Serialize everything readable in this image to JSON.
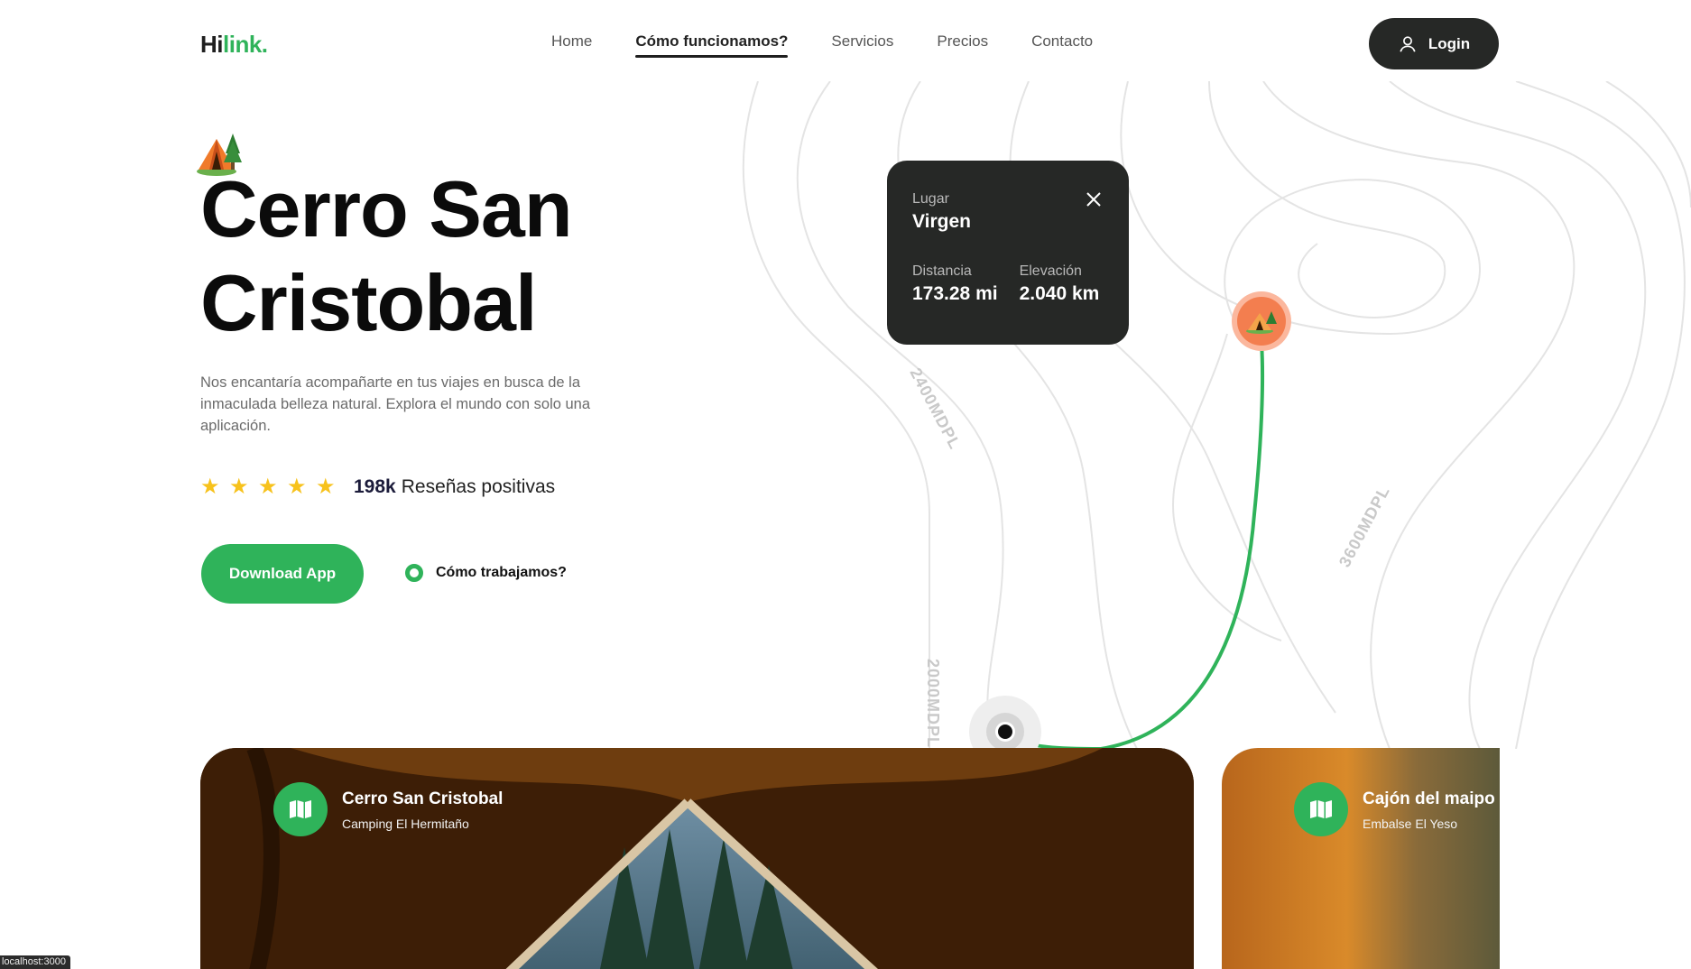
{
  "header": {
    "logo_hi": "Hi",
    "logo_link": "link.",
    "nav": [
      {
        "label": "Home",
        "active": false
      },
      {
        "label": "Cómo funcionamos?",
        "active": true
      },
      {
        "label": "Servicios",
        "active": false
      },
      {
        "label": "Precios",
        "active": false
      },
      {
        "label": "Contacto",
        "active": false
      }
    ],
    "login_label": "Login"
  },
  "hero": {
    "title_line1": "Cerro San",
    "title_line2": "Cristobal",
    "description": "Nos encantaría acompañarte en tus viajes en busca de la inmaculada belleza natural. Explora el mundo con solo una aplicación.",
    "rating_stars": 5,
    "rating_count": "198k",
    "rating_label": "Reseñas positivas",
    "download_label": "Download App",
    "how_label": "Cómo trabajamos?"
  },
  "map": {
    "contour_labels": [
      "2400MDPL",
      "3600MDPL",
      "2000MDPL"
    ],
    "route_color": "#2fb35a",
    "pin_color": "#f37e4f",
    "info": {
      "place_label": "Lugar",
      "place_value": "Virgen",
      "distance_label": "Distancia",
      "distance_value": "173.28 mi",
      "elevation_label": "Elevación",
      "elevation_value": "2.040 km"
    }
  },
  "cards": [
    {
      "title": "Cerro San Cristobal",
      "subtitle": "Camping El Hermitaño",
      "icon": "map-icon"
    },
    {
      "title": "Cajón del maipo",
      "subtitle": "Embalse El Yeso",
      "icon": "map-icon"
    }
  ],
  "status": {
    "url": "localhost:3000"
  },
  "colors": {
    "accent": "#2fb35a",
    "dark": "#262826",
    "star": "#f7c21c"
  }
}
